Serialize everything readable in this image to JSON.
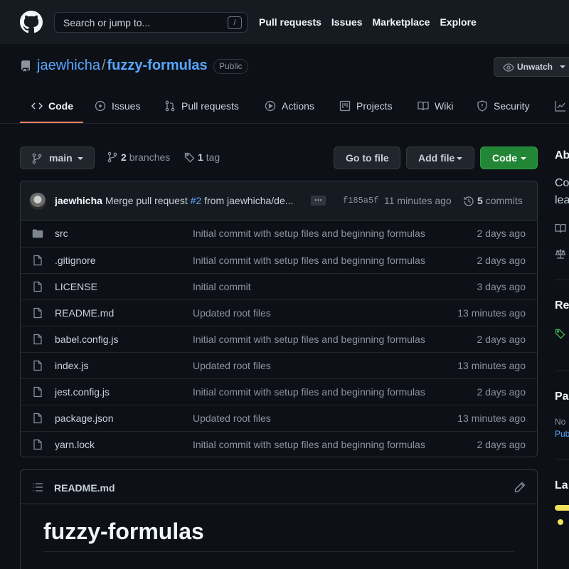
{
  "header": {
    "search_placeholder": "Search or jump to...",
    "search_shortcut": "/",
    "nav": [
      "Pull requests",
      "Issues",
      "Marketplace",
      "Explore"
    ]
  },
  "repo": {
    "owner": "jaewhicha",
    "separator": "/",
    "name": "fuzzy-formulas",
    "visibility": "Public",
    "watch_label": "Unwatch"
  },
  "tabs": [
    {
      "label": "Code",
      "icon": "code-icon",
      "selected": true
    },
    {
      "label": "Issues",
      "icon": "issue-icon"
    },
    {
      "label": "Pull requests",
      "icon": "pull-request-icon"
    },
    {
      "label": "Actions",
      "icon": "play-icon"
    },
    {
      "label": "Projects",
      "icon": "project-icon"
    },
    {
      "label": "Wiki",
      "icon": "book-icon"
    },
    {
      "label": "Security",
      "icon": "shield-icon"
    }
  ],
  "branch": {
    "current": "main",
    "branches_count": "2",
    "branches_label": "branches",
    "tags_count": "1",
    "tags_label": "tag",
    "goto_file": "Go to file",
    "add_file": "Add file",
    "code": "Code"
  },
  "latest_commit": {
    "author": "jaewhicha",
    "message_prefix": "Merge pull request",
    "pr_ref": "#2",
    "message_suffix": "from jaewhicha/de...",
    "sha": "f185a5f",
    "time": "11 minutes ago",
    "commits_count": "5",
    "commits_label": "commits"
  },
  "files": [
    {
      "name": "src",
      "type": "dir",
      "commit": "Initial commit with setup files and beginning formulas",
      "age": "2 days ago"
    },
    {
      "name": ".gitignore",
      "type": "file",
      "commit": "Initial commit with setup files and beginning formulas",
      "age": "2 days ago"
    },
    {
      "name": "LICENSE",
      "type": "file",
      "commit": "Initial commit",
      "age": "3 days ago"
    },
    {
      "name": "README.md",
      "type": "file",
      "commit": "Updated root files",
      "age": "13 minutes ago"
    },
    {
      "name": "babel.config.js",
      "type": "file",
      "commit": "Initial commit with setup files and beginning formulas",
      "age": "2 days ago"
    },
    {
      "name": "index.js",
      "type": "file",
      "commit": "Updated root files",
      "age": "13 minutes ago"
    },
    {
      "name": "jest.config.js",
      "type": "file",
      "commit": "Initial commit with setup files and beginning formulas",
      "age": "2 days ago"
    },
    {
      "name": "package.json",
      "type": "file",
      "commit": "Updated root files",
      "age": "13 minutes ago"
    },
    {
      "name": "yarn.lock",
      "type": "file",
      "commit": "Initial commit with setup files and beginning formulas",
      "age": "2 days ago"
    }
  ],
  "readme": {
    "filename": "README.md",
    "title": "fuzzy-formulas"
  },
  "sidebar": {
    "about_heading": "Ab",
    "about_line1": "Co",
    "about_line2": "lea",
    "releases_heading": "Re",
    "packages_heading": "Pa",
    "packages_text": "No",
    "packages_link": "Pub",
    "languages_heading": "La"
  },
  "colors": {
    "accent": "#58a6ff",
    "tab_underline": "#f78166",
    "code_button": "#238636",
    "language_js": "#f1e05a"
  }
}
